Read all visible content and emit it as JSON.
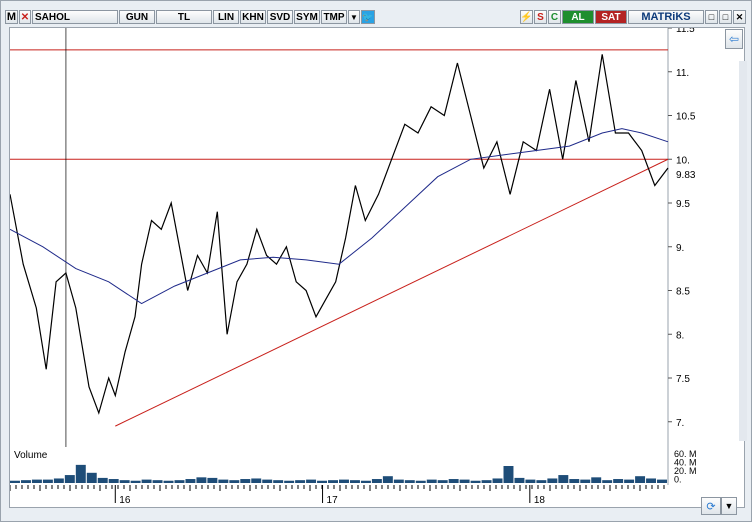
{
  "toolbar": {
    "m_label": "M",
    "close_glyph": "✕",
    "symbol": "SAHOL",
    "period": "GUN",
    "currency": "TL",
    "scale": "LIN",
    "khn": "KHN",
    "svd": "SVD",
    "sym": "SYM",
    "tmp": "TMP",
    "dropdown_glyph": "▼",
    "twitter_icon": "twitter-icon",
    "s_label": "S",
    "c_label": "C",
    "buy_label": "AL",
    "sell_label": "SAT",
    "brand": "MATRiKS",
    "win_min": "□",
    "win_max": "□",
    "win_close": "✕"
  },
  "colors": {
    "price_line": "#000000",
    "ma_line": "#1f2a8a",
    "trend_line": "#c8201b",
    "horizontal_lines": "#c8201b",
    "volume_bars": "#1e4d78",
    "buy_bg": "#1e8e2e",
    "sell_bg": "#b32323",
    "grid_border": "#9aa3ad"
  },
  "volume_panel": {
    "label": "Volume",
    "tick_labels": [
      "60. M",
      "40. M",
      "20. M",
      "0."
    ]
  },
  "x_axis_labels": [
    "16",
    "17",
    "18"
  ],
  "chart_data": {
    "type": "line",
    "symbol": "SAHOL",
    "y_ticks": [
      "11.5",
      "11.",
      "10.5",
      "10.",
      "9.5",
      "9.",
      "8.5",
      "8.",
      "7.5",
      "7."
    ],
    "y_range": [
      6.7,
      11.5
    ],
    "last_price_label": "9.83",
    "last_price": 9.83,
    "horizontal_levels": [
      11.25,
      10.0
    ],
    "trendline": {
      "from": {
        "x": 0.16,
        "y": 6.95
      },
      "to": {
        "x": 1.0,
        "y": 10.0
      }
    },
    "cursor_line_x": 0.085,
    "series": [
      {
        "name": "price",
        "x": [
          0.0,
          0.02,
          0.04,
          0.055,
          0.07,
          0.085,
          0.1,
          0.12,
          0.135,
          0.15,
          0.16,
          0.175,
          0.19,
          0.2,
          0.215,
          0.23,
          0.245,
          0.26,
          0.27,
          0.285,
          0.3,
          0.315,
          0.33,
          0.345,
          0.36,
          0.375,
          0.39,
          0.405,
          0.42,
          0.435,
          0.45,
          0.465,
          0.48,
          0.495,
          0.51,
          0.525,
          0.54,
          0.56,
          0.58,
          0.6,
          0.62,
          0.64,
          0.66,
          0.68,
          0.7,
          0.72,
          0.74,
          0.76,
          0.78,
          0.8,
          0.82,
          0.84,
          0.86,
          0.88,
          0.9,
          0.92,
          0.94,
          0.96,
          0.98,
          1.0
        ],
        "y": [
          9.6,
          8.8,
          8.3,
          7.6,
          8.6,
          8.7,
          8.3,
          7.4,
          7.1,
          7.5,
          7.3,
          7.8,
          8.2,
          8.8,
          9.3,
          9.2,
          9.5,
          8.9,
          8.5,
          8.9,
          8.7,
          9.4,
          8.0,
          8.6,
          8.8,
          9.2,
          8.9,
          8.8,
          9.0,
          8.6,
          8.5,
          8.2,
          8.4,
          8.6,
          9.1,
          9.7,
          9.3,
          9.6,
          10.0,
          10.4,
          10.3,
          10.6,
          10.5,
          11.1,
          10.5,
          9.9,
          10.2,
          9.6,
          10.2,
          10.1,
          10.8,
          10.0,
          10.9,
          10.2,
          11.2,
          10.3,
          10.3,
          10.1,
          9.7,
          9.9
        ],
        "color": "#000000"
      },
      {
        "name": "moving-average",
        "x": [
          0.0,
          0.05,
          0.1,
          0.15,
          0.2,
          0.25,
          0.3,
          0.35,
          0.4,
          0.45,
          0.5,
          0.55,
          0.6,
          0.65,
          0.7,
          0.75,
          0.8,
          0.85,
          0.9,
          0.93,
          0.96,
          1.0
        ],
        "y": [
          9.2,
          9.0,
          8.75,
          8.6,
          8.35,
          8.55,
          8.7,
          8.85,
          8.88,
          8.85,
          8.8,
          9.1,
          9.45,
          9.8,
          10.0,
          10.05,
          10.1,
          10.15,
          10.3,
          10.35,
          10.3,
          10.2
        ],
        "color": "#1f2a8a"
      }
    ],
    "volume": {
      "values": [
        4,
        5,
        6,
        6,
        8,
        14,
        32,
        18,
        9,
        7,
        5,
        4,
        6,
        5,
        4,
        5,
        7,
        10,
        9,
        6,
        5,
        7,
        8,
        6,
        5,
        4,
        5,
        6,
        4,
        5,
        6,
        5,
        4,
        7,
        12,
        6,
        5,
        4,
        6,
        5,
        7,
        6,
        4,
        5,
        8,
        30,
        9,
        6,
        5,
        8,
        14,
        7,
        6,
        10,
        5,
        7,
        6,
        12,
        8,
        6
      ],
      "range": [
        0,
        60
      ]
    }
  }
}
